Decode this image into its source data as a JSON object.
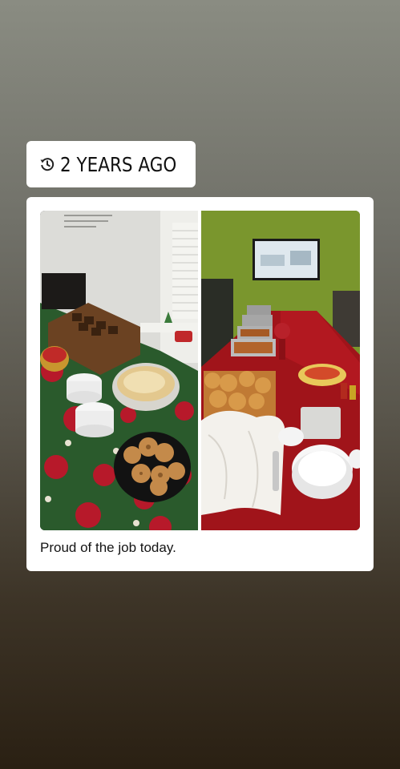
{
  "memory": {
    "label": "2 YEARS AGO",
    "icon": "history-icon"
  },
  "post": {
    "caption": "Proud of the job today.",
    "photo": {
      "description_icon": "collage-photo",
      "left_scene": "dessert-table",
      "right_scene": "buffet-table"
    }
  },
  "colors": {
    "background_top": "#8a8c82",
    "background_bottom": "#2a2013",
    "card": "#ffffff",
    "text": "#141414"
  }
}
